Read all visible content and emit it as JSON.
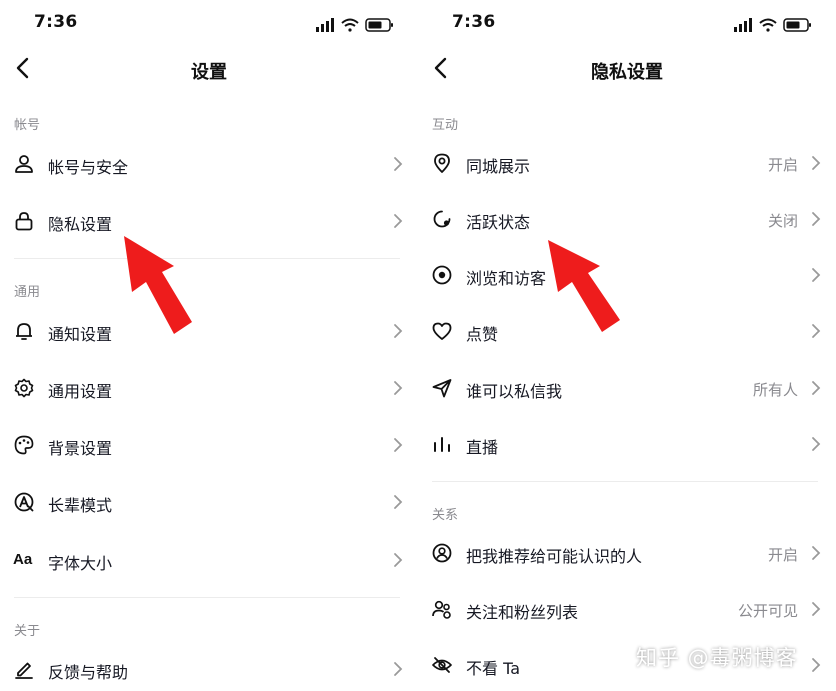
{
  "left": {
    "time": "7:36",
    "title": "设置",
    "sections": [
      {
        "header": "帐号",
        "items": [
          {
            "label": "帐号与安全",
            "icon": "person-icon"
          },
          {
            "label": "隐私设置",
            "icon": "lock-icon"
          }
        ]
      },
      {
        "header": "通用",
        "items": [
          {
            "label": "通知设置",
            "icon": "bell-icon"
          },
          {
            "label": "通用设置",
            "icon": "gear-icon"
          },
          {
            "label": "背景设置",
            "icon": "palette-icon"
          },
          {
            "label": "长辈模式",
            "icon": "elder-mode-icon"
          },
          {
            "label": "字体大小",
            "icon": "font-size-icon",
            "icon_text": "Aa"
          }
        ]
      },
      {
        "header": "关于",
        "items": [
          {
            "label": "反馈与帮助",
            "icon": "edit-icon"
          }
        ]
      }
    ]
  },
  "right": {
    "time": "7:36",
    "title": "隐私设置",
    "sections": [
      {
        "header": "互动",
        "items": [
          {
            "label": "同城展示",
            "value": "开启",
            "icon": "location-pin-icon"
          },
          {
            "label": "活跃状态",
            "value": "关闭",
            "icon": "activity-status-icon"
          },
          {
            "label": "浏览和访客",
            "value": "",
            "icon": "eye-icon"
          },
          {
            "label": "点赞",
            "value": "",
            "icon": "heart-icon"
          },
          {
            "label": "谁可以私信我",
            "value": "所有人",
            "icon": "send-icon"
          },
          {
            "label": "直播",
            "value": "",
            "icon": "live-bars-icon"
          }
        ]
      },
      {
        "header": "关系",
        "items": [
          {
            "label": "把我推荐给可能认识的人",
            "value": "开启",
            "icon": "user-circle-icon"
          },
          {
            "label": "关注和粉丝列表",
            "value": "公开可见",
            "icon": "users-icon"
          },
          {
            "label": "不看 Ta",
            "value": "",
            "icon": "eye-off-icon"
          }
        ]
      }
    ]
  },
  "watermark": "知乎 @毒粥博客",
  "colors": {
    "arrow": "#ee1c1c",
    "secondary_text": "#8a8a8f",
    "divider": "#ececec"
  }
}
